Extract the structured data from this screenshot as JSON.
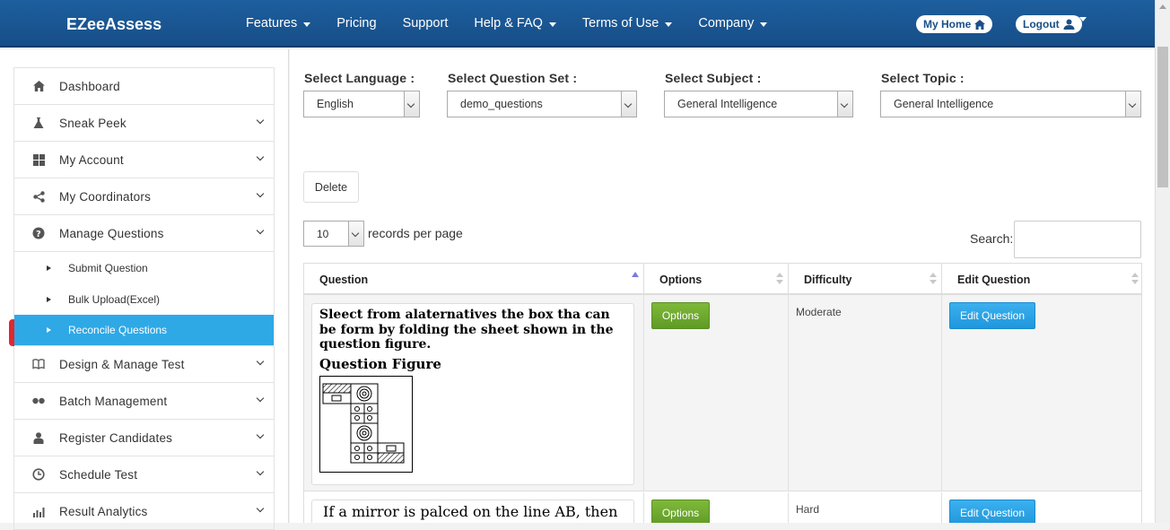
{
  "brand": "EZeeAssess",
  "nav": [
    {
      "label": "Features",
      "caret": true
    },
    {
      "label": "Pricing",
      "caret": false
    },
    {
      "label": "Support",
      "caret": false
    },
    {
      "label": "Help & FAQ",
      "caret": true
    },
    {
      "label": "Terms of Use",
      "caret": true
    },
    {
      "label": "Company",
      "caret": true
    }
  ],
  "my_home": "My Home",
  "logout": "Logout",
  "sidebar": {
    "items": [
      {
        "label": "Dashboard",
        "icon": "home-icon"
      },
      {
        "label": "Sneak Peek",
        "icon": "flask-icon"
      },
      {
        "label": "My Account",
        "icon": "grid-icon"
      },
      {
        "label": "My Coordinators",
        "icon": "share-icon"
      },
      {
        "label": "Manage Questions",
        "icon": "question-circle-icon"
      },
      {
        "label": "Design & Manage Test",
        "icon": "book-icon"
      },
      {
        "label": "Batch Management",
        "icon": "dots-icon"
      },
      {
        "label": "Register Candidates",
        "icon": "user-icon"
      },
      {
        "label": "Schedule Test",
        "icon": "clock-icon"
      },
      {
        "label": "Result Analytics",
        "icon": "chart-icon"
      }
    ],
    "subitems": [
      "Submit Question",
      "Bulk Upload(Excel)",
      "Reconcile Questions"
    ]
  },
  "filters": {
    "language": {
      "label": "Select Language :",
      "value": "English"
    },
    "question_set": {
      "label": "Select Question Set :",
      "value": "demo_questions"
    },
    "subject": {
      "label": "Select Subject :",
      "value": "General Intelligence"
    },
    "topic": {
      "label": "Select Topic :",
      "value": "General Intelligence"
    }
  },
  "delete_label": "Delete",
  "records_per_page": {
    "value": "10",
    "label": "records per page"
  },
  "search_label": "Search:",
  "table": {
    "headers": [
      "Question",
      "Options",
      "Difficulty",
      "Edit Question"
    ],
    "rows": [
      {
        "question": "Sleect from alaternatives the box tha can be form by folding the sheet shown in the question figure.",
        "figure_label": "Question Figure",
        "options_btn": "Options",
        "difficulty": "Moderate",
        "edit_btn": "Edit Question"
      },
      {
        "question": "If a mirror is palced on the line AB, then",
        "options_btn": "Options",
        "difficulty": "Hard",
        "edit_btn": "Edit Question"
      }
    ]
  },
  "colors": {
    "header": "#1d5f9f",
    "active": "#2fa8e6",
    "green": "#6aa82e",
    "blue": "#2aa3e6",
    "active_marker": "#e0282e"
  }
}
